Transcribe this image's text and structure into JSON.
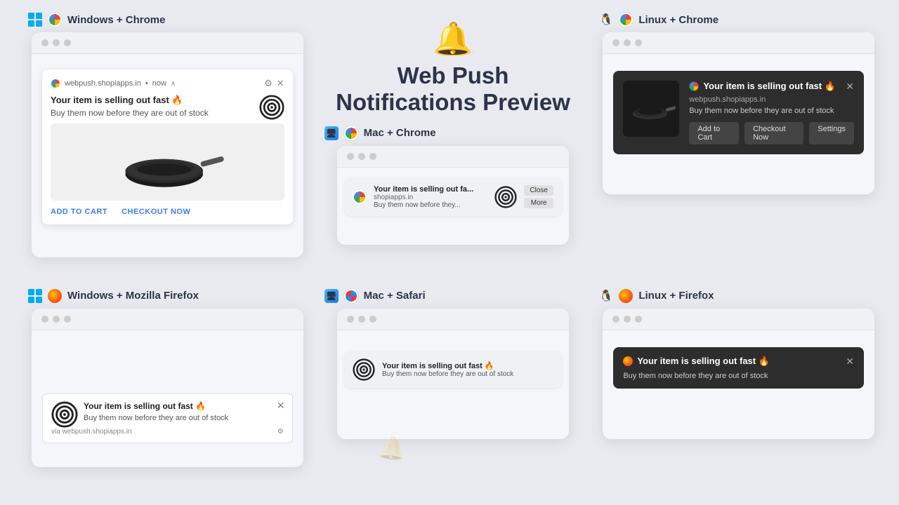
{
  "hero": {
    "icon": "🔔",
    "title_line1": "Web Push",
    "title_line2": "Notifications Preview"
  },
  "notification": {
    "title": "Your item is selling out fast 🔥",
    "body": "Buy them now before they are out of stock",
    "title_truncated": "Your item is selling out fa...",
    "body_truncated": "Buy them now before they...",
    "site": "webpush.shopiapps.in",
    "site_short": "shopiapps.in",
    "timestamp": "now",
    "actions": {
      "add_to_cart": "ADD TO CART",
      "checkout_now": "CHECKOUT NOW",
      "add_to_cart_dark": "Add to Cart",
      "checkout_now_dark": "Checkout Now",
      "settings_dark": "Settings",
      "close": "Close",
      "more": "More"
    }
  },
  "platforms": {
    "win_chrome": "Windows + Chrome",
    "mac_chrome": "Mac + Chrome",
    "linux_chrome": "Linux + Chrome",
    "win_firefox": "Windows + Mozilla Firefox",
    "mac_safari": "Mac + Safari",
    "linux_firefox": "Linux + Firefox"
  },
  "footer": {
    "via": "via webpush.shopiapps.in"
  }
}
